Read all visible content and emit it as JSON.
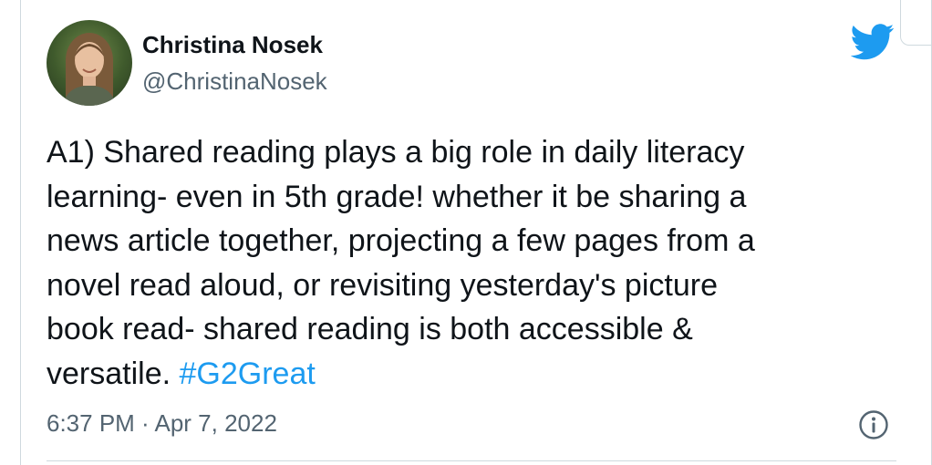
{
  "tweet": {
    "author": {
      "display_name": "Christina Nosek",
      "handle": "@ChristinaNosek",
      "avatar_icon": "profile-photo"
    },
    "text_lines": [
      "A1) Shared reading plays a big role in daily literacy",
      "learning- even in 5th grade! whether it be sharing a",
      "news article together, projecting a few pages from a",
      "novel read aloud, or revisiting yesterday's picture",
      "book read- shared reading is both accessible &",
      "versatile."
    ],
    "hashtag": "#G2Great",
    "timestamp": "6:37 PM · Apr 7, 2022",
    "brand_icon": "twitter-bird-icon",
    "info_icon": "info-icon"
  },
  "colors": {
    "text": "#0f1419",
    "secondary": "#536471",
    "accent": "#1d9bf0",
    "border": "#cfd9de"
  }
}
